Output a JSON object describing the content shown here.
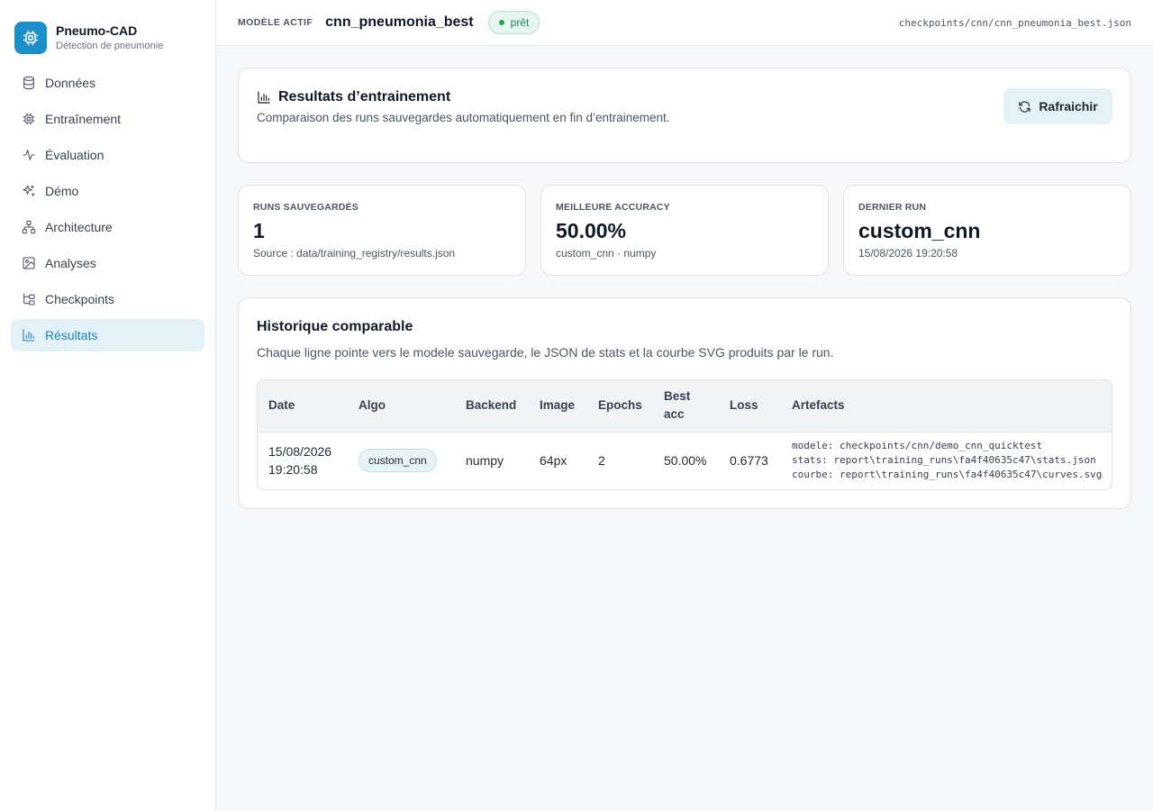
{
  "brand": {
    "title": "Pneumo-CAD",
    "subtitle": "Détection de pneumonie",
    "logo_icon": "chip-icon",
    "color": "#1b8fc8"
  },
  "sidebar": {
    "items": [
      {
        "label": "Données",
        "icon": "database-icon",
        "active": false
      },
      {
        "label": "Entraînement",
        "icon": "chip-icon",
        "active": false
      },
      {
        "label": "Évaluation",
        "icon": "activity-icon",
        "active": false
      },
      {
        "label": "Démo",
        "icon": "sparkles-icon",
        "active": false
      },
      {
        "label": "Architecture",
        "icon": "network-icon",
        "active": false
      },
      {
        "label": "Analyses",
        "icon": "image-icon",
        "active": false
      },
      {
        "label": "Checkpoints",
        "icon": "folder-tree-icon",
        "active": false
      },
      {
        "label": "Résultats",
        "icon": "bar-chart-icon",
        "active": true
      }
    ]
  },
  "topbar": {
    "model_label": "MODÈLE ACTIF",
    "model_name": "cnn_pneumonia_best",
    "status": "prêt",
    "status_color": "#22a05a",
    "checkpoint_path": "checkpoints/cnn/cnn_pneumonia_best.json"
  },
  "header": {
    "title": "Resultats d’entrainement",
    "subtitle": "Comparaison des runs sauvegardes automatiquement en fin d’entrainement.",
    "refresh_label": "Rafraichir"
  },
  "stats": [
    {
      "label": "RUNS SAUVEGARDÉS",
      "value": "1",
      "note": "Source : data/training_registry/results.json"
    },
    {
      "label": "MEILLEURE ACCURACY",
      "value": "50.00%",
      "note": "custom_cnn · numpy"
    },
    {
      "label": "DERNIER RUN",
      "value": "custom_cnn",
      "note": "15/08/2026 19:20:58"
    }
  ],
  "history": {
    "title": "Historique comparable",
    "subtitle": "Chaque ligne pointe vers le modele sauvegarde, le JSON de stats et la courbe SVG produits par le run.",
    "columns": [
      "Date",
      "Algo",
      "Backend",
      "Image",
      "Epochs",
      "Best acc",
      "Loss",
      "Artefacts"
    ],
    "rows": [
      {
        "date": "15/08/2026",
        "time": "19:20:58",
        "algo": "custom_cnn",
        "backend": "numpy",
        "image": "64px",
        "epochs": "2",
        "best_acc": "50.00%",
        "loss": "0.6773",
        "artefacts": {
          "modele": "modele: checkpoints/cnn/demo_cnn_quicktest",
          "stats": "stats: report\\training_runs\\fa4f40635c47\\stats.json",
          "courbe": "courbe: report\\training_runs\\fa4f40635c47\\curves.svg"
        }
      }
    ]
  }
}
